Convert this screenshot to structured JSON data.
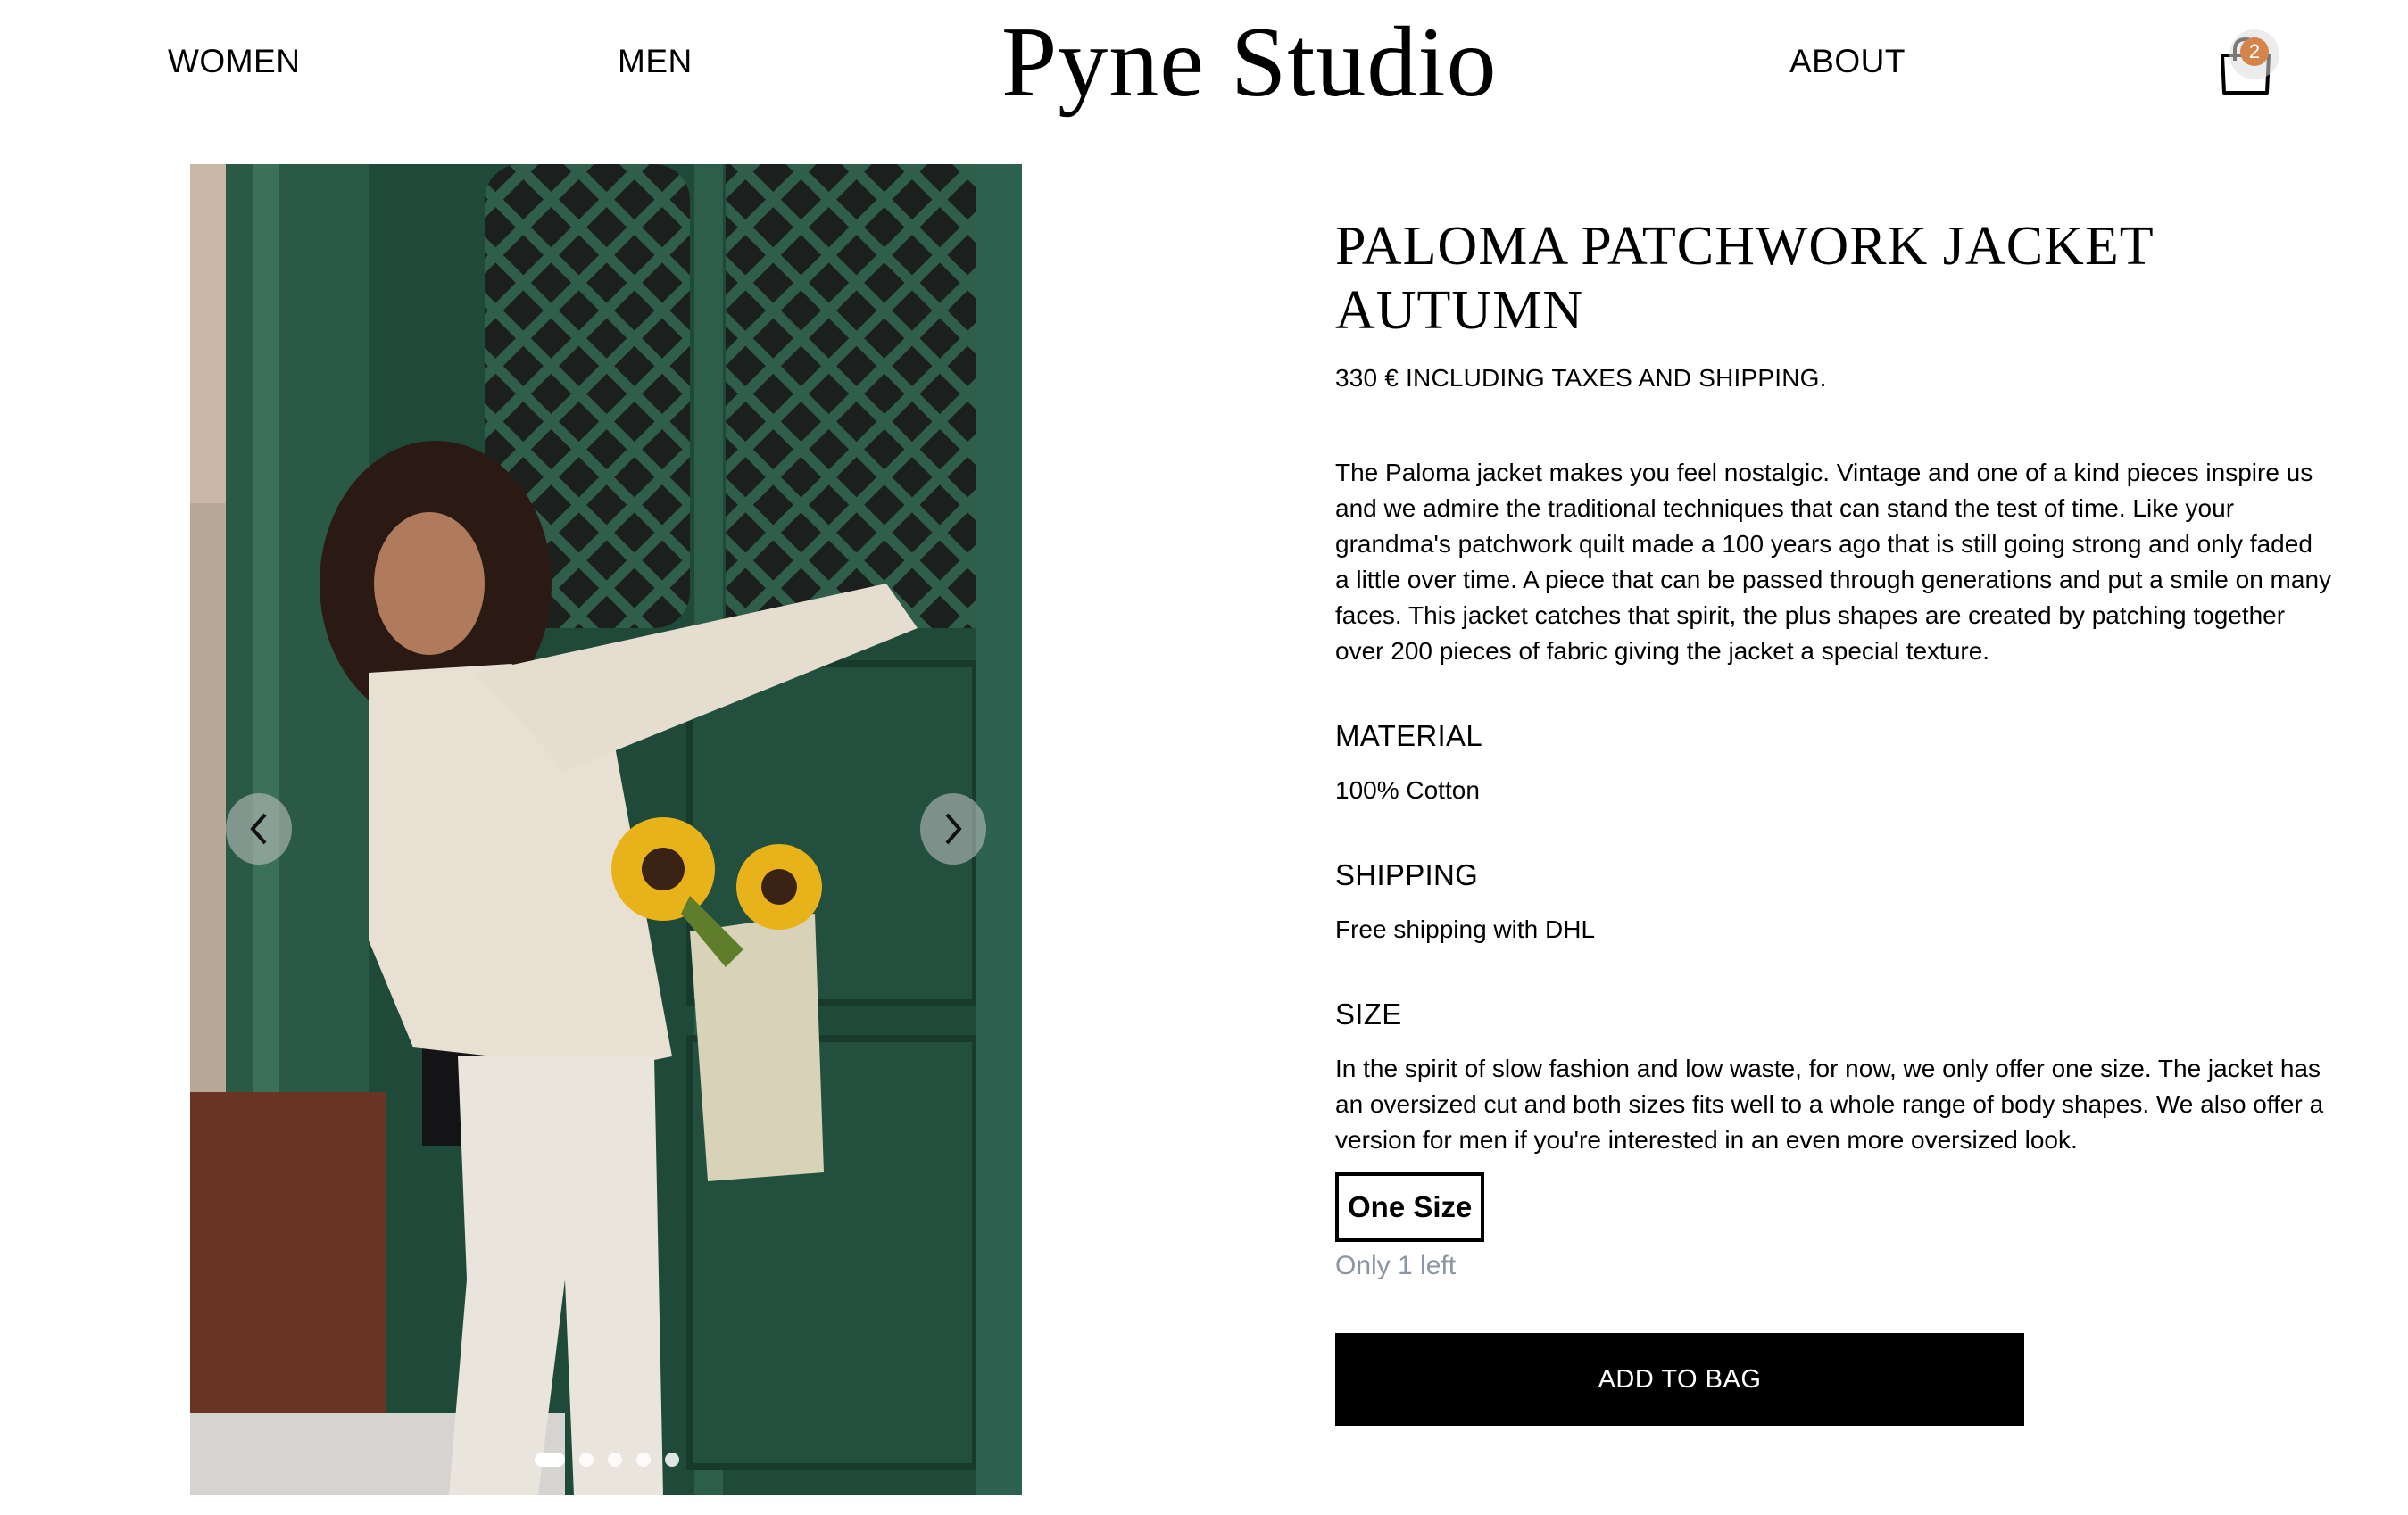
{
  "nav": {
    "women": "WOMEN",
    "men": "MEN",
    "logo": "Pyne Studio",
    "about": "ABOUT",
    "cart_count": "2",
    "cart_icon": "shopping-bag-icon"
  },
  "gallery": {
    "prev_icon": "chevron-left-icon",
    "next_icon": "chevron-right-icon",
    "slide_count": 5,
    "active_slide": 1
  },
  "product": {
    "title_line1": "PALOMA PATCHWORK JACKET",
    "title_line2": "AUTUMN",
    "price": "330 € INCLUDING TAXES AND SHIPPING.",
    "description": "The Paloma jacket makes you feel nostalgic. Vintage and one of a kind pieces inspire us and we admire the traditional techniques that can stand the test of time. Like your grandma's patchwork quilt made a 100 years ago that is still going strong and only faded a little over time. A piece that can be passed through generations and put a smile on many faces. This jacket catches that spirit, the plus shapes are created by patching together over 200 pieces of fabric giving the jacket a special texture.",
    "material_heading": "MATERIAL",
    "material_text": "100% Cotton",
    "shipping_heading": "SHIPPING",
    "shipping_text": "Free shipping with DHL",
    "size_heading": "SIZE",
    "size_text": "In the spirit of slow fashion and low waste, for now, we only offer one size. The jacket has an oversized cut and both sizes fits well to a whole range of body shapes. We also offer a version for men if you're interested in an even more oversized look.",
    "size_option": "One Size",
    "stock": "Only 1 left",
    "add_to_bag": "ADD TO BAG"
  },
  "colors": {
    "badge": "#d4854c",
    "stock_text": "#8b95a4",
    "button_bg": "#000000"
  }
}
